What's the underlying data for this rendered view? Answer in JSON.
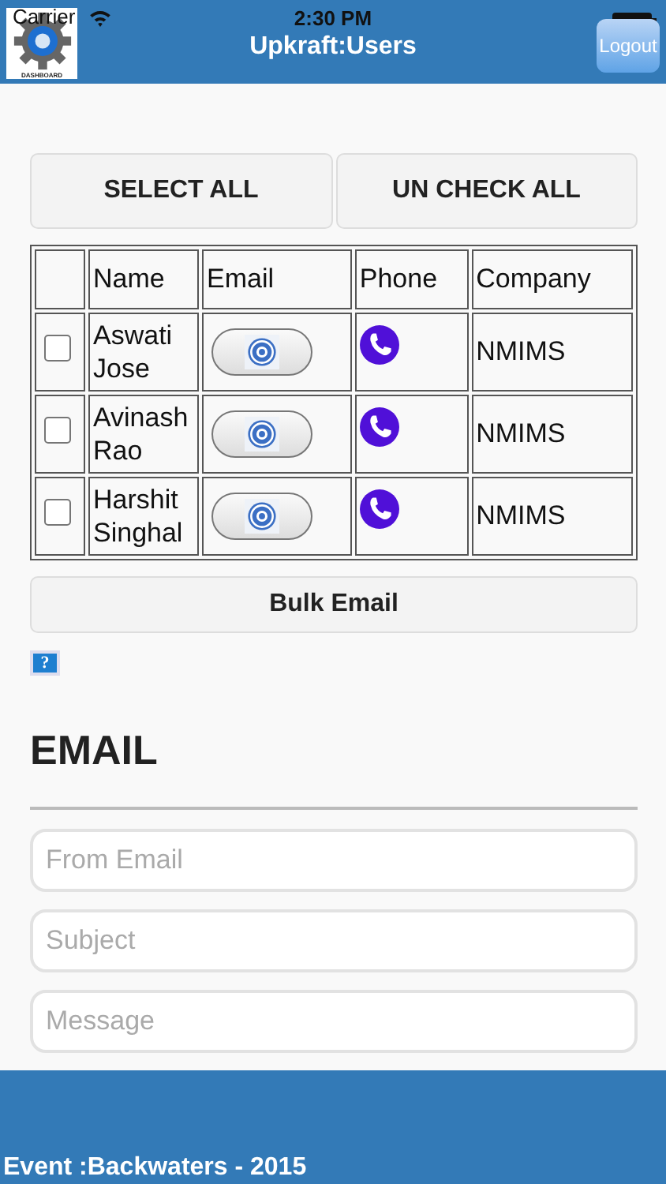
{
  "status_bar": {
    "carrier": "Carrier",
    "time": "2:30 PM"
  },
  "header": {
    "logo_caption": "DASHBOARD",
    "title": "Upkraft:Users",
    "logout": "Logout"
  },
  "actions": [
    "SELECT ALL",
    "UN CHECK ALL"
  ],
  "table": {
    "columns": [
      "Name",
      "Email",
      "Phone",
      "Company"
    ],
    "rows": [
      {
        "checked": false,
        "name": "Aswati Jose",
        "company": "NMIMS"
      },
      {
        "checked": false,
        "name": "Avinash Rao",
        "company": "NMIMS"
      },
      {
        "checked": false,
        "name": "Harshit Singhal",
        "company": "NMIMS"
      }
    ]
  },
  "bulk_button": "Bulk Email",
  "help": "?",
  "email_form": {
    "heading": "EMAIL",
    "fields": [
      {
        "placeholder": "From Email"
      },
      {
        "placeholder": "Subject"
      },
      {
        "placeholder": "Message"
      }
    ]
  },
  "footer": "Event :Backwaters - 2015"
}
